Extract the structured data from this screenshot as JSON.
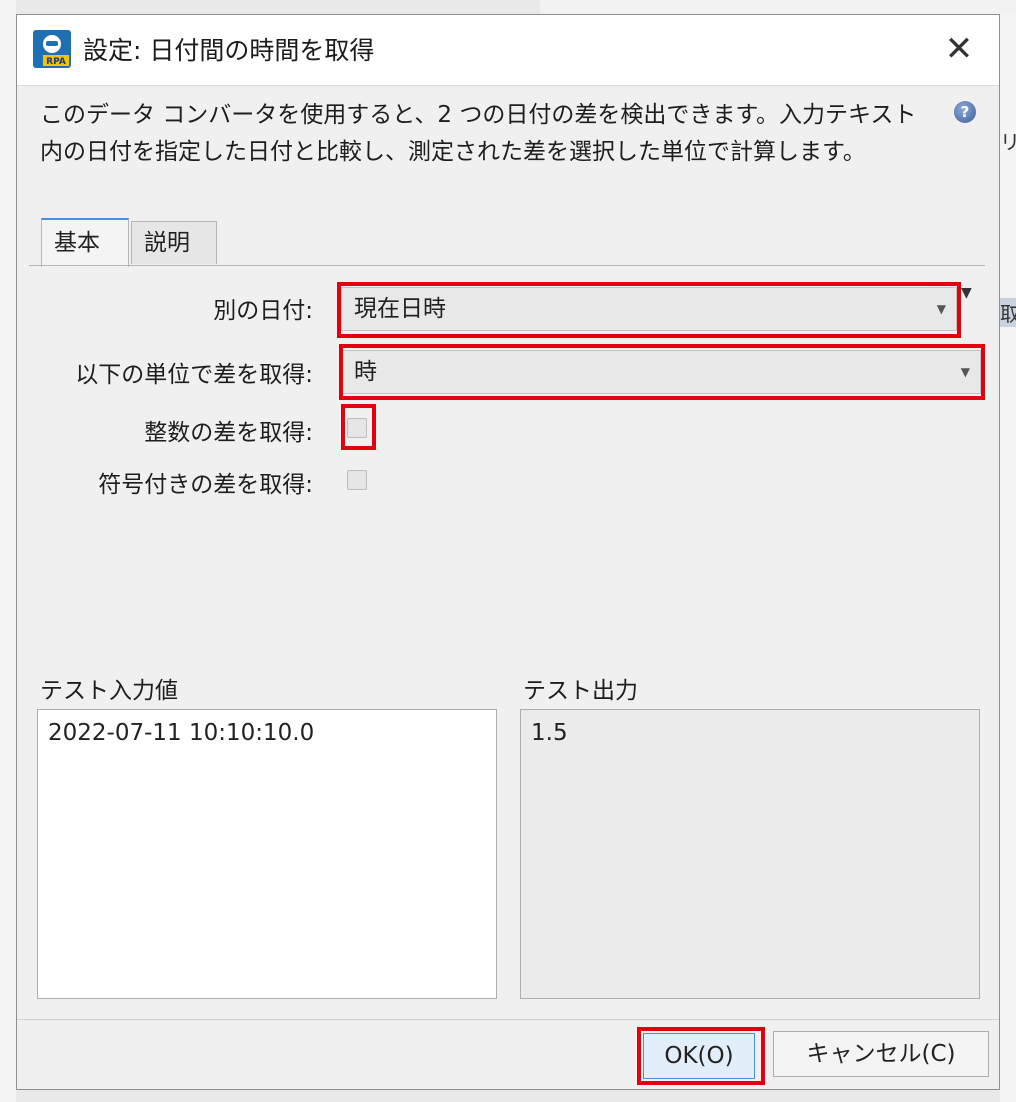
{
  "dialog": {
    "title": "設定: 日付間の時間を取得",
    "close_glyph": "✕",
    "description": "このデータ コンバータを使用すると、2 つの日付の差を検出できます。入力テキスト内の日付を指定した日付と比較し、測定された差を選択した単位で計算します。",
    "help_glyph": "?",
    "icon_badge": "RPA"
  },
  "tabs": [
    {
      "label": "基本",
      "active": true
    },
    {
      "label": "説明",
      "active": false
    }
  ],
  "form": {
    "other_date": {
      "label": "別の日付:",
      "value": "現在日時"
    },
    "unit": {
      "label": "以下の単位で差を取得:",
      "value": "時"
    },
    "integer_diff": {
      "label": "整数の差を取得:",
      "checked": false
    },
    "signed_diff": {
      "label": "符号付きの差を取得:",
      "checked": false
    }
  },
  "test": {
    "input_label": "テスト入力値",
    "input_value": "2022-07-11 10:10:10.0",
    "output_label": "テスト出力",
    "output_value": "1.5"
  },
  "buttons": {
    "ok_label": "OK(O)",
    "cancel_label": "キャンセル(C)"
  },
  "colors": {
    "highlight": "#e3000f",
    "tab_accent": "#4a90e2"
  },
  "background_fragments": [
    "リ",
    "取"
  ]
}
